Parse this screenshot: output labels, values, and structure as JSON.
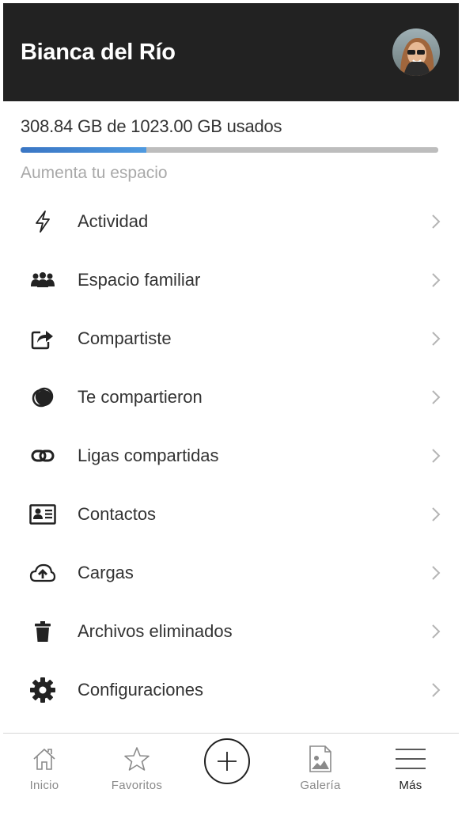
{
  "header": {
    "user_name": "Bianca del Río"
  },
  "storage": {
    "usage_text": "308.84 GB de 1023.00 GB usados",
    "used_gb": 308.84,
    "total_gb": 1023.0,
    "upgrade_link": "Aumenta tu espacio"
  },
  "menu": {
    "items": [
      {
        "label": "Actividad",
        "icon": "activity-bolt-icon"
      },
      {
        "label": "Espacio familiar",
        "icon": "family-icon"
      },
      {
        "label": "Compartiste",
        "icon": "share-icon"
      },
      {
        "label": "Te compartieron",
        "icon": "shared-with-you-icon"
      },
      {
        "label": "Ligas compartidas",
        "icon": "link-icon"
      },
      {
        "label": "Contactos",
        "icon": "contact-card-icon"
      },
      {
        "label": "Cargas",
        "icon": "cloud-upload-icon"
      },
      {
        "label": "Archivos eliminados",
        "icon": "trash-icon"
      },
      {
        "label": "Configuraciones",
        "icon": "gear-icon"
      }
    ]
  },
  "tabbar": {
    "home": "Inicio",
    "favorites": "Favoritos",
    "gallery": "Galería",
    "more": "Más"
  },
  "colors": {
    "header_bg": "#222222",
    "progress_fill": "#3a76c4",
    "progress_track": "#bdbdbd"
  }
}
